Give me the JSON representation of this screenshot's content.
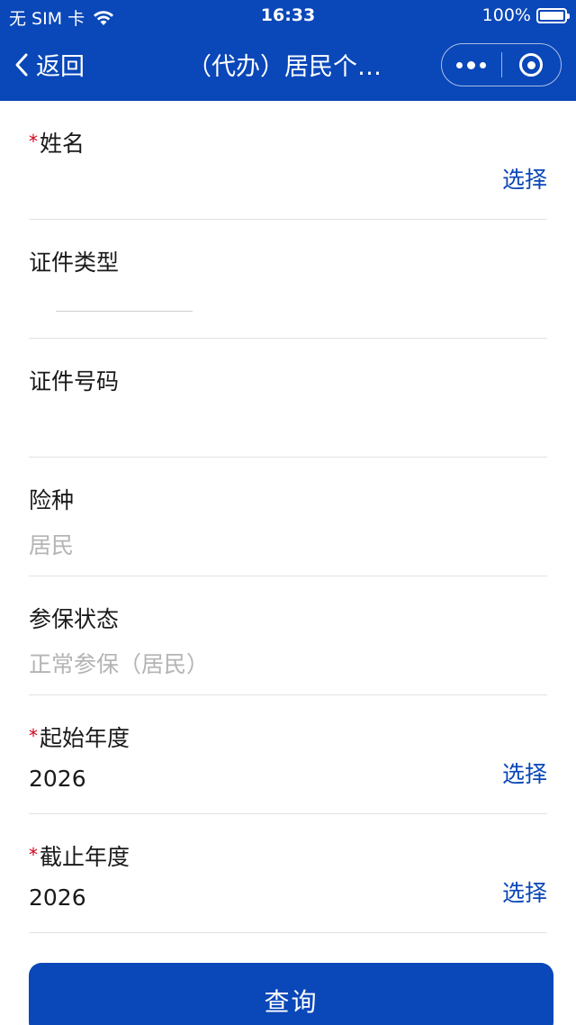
{
  "status_bar": {
    "carrier": "无 SIM 卡",
    "time": "16:33",
    "battery": "100%",
    "battery_level": 1.0
  },
  "nav": {
    "back_label": "返回",
    "title": "（代办）居民个…",
    "icons": {
      "back": "chevron-left-icon",
      "more": "more-dots-icon",
      "close": "target-circle-icon"
    }
  },
  "form": {
    "fields": [
      {
        "label": "姓名",
        "required": true,
        "value": "",
        "action": "选择"
      },
      {
        "label": "证件类型",
        "required": false,
        "value": "",
        "action": ""
      },
      {
        "label": "证件号码",
        "required": false,
        "value": "",
        "action": ""
      },
      {
        "label": "险种",
        "required": false,
        "value": "居民",
        "action": ""
      },
      {
        "label": "参保状态",
        "required": false,
        "value": "正常参保（居民）",
        "action": ""
      },
      {
        "label": "起始年度",
        "required": true,
        "value": "2026",
        "action": "选择"
      },
      {
        "label": "截止年度",
        "required": true,
        "value": "2026",
        "action": "选择"
      }
    ],
    "required_mark": "*"
  },
  "submit_label": "查询",
  "colors": {
    "brand": "#0a47b8",
    "required": "#d0021b",
    "muted_text": "#b4b4b4",
    "divider": "#e2e2e2"
  }
}
